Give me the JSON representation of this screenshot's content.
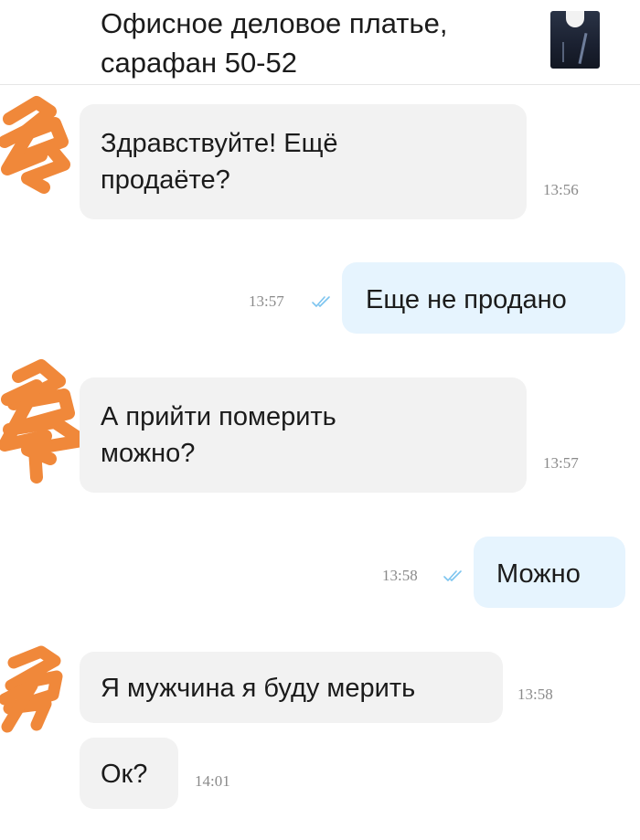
{
  "header": {
    "title_line1": "Офисное деловое платье,",
    "title_line2": "сарафан 50-52",
    "thumbnail_icon": "dress-thumbnail"
  },
  "colors": {
    "incoming_bubble": "#f2f2f2",
    "outgoing_bubble": "#e6f4fe",
    "redaction": "#f0883a",
    "read_check": "#7cc4ef"
  },
  "messages": [
    {
      "direction": "in",
      "line1": "Здравствуйте! Ещё",
      "line2": "продаёте?",
      "time": "13:56"
    },
    {
      "direction": "out",
      "text": "Еще не продано",
      "time": "13:57",
      "status_icon": "double-check-icon"
    },
    {
      "direction": "in",
      "line1": "А прийти померить",
      "line2": "можно?",
      "time": "13:57"
    },
    {
      "direction": "out",
      "text": "Можно",
      "time": "13:58",
      "status_icon": "double-check-icon"
    },
    {
      "direction": "in",
      "text": "Я мужчина я буду мерить",
      "time": "13:58"
    },
    {
      "direction": "in",
      "text": "Ок?",
      "time": "14:01"
    }
  ]
}
